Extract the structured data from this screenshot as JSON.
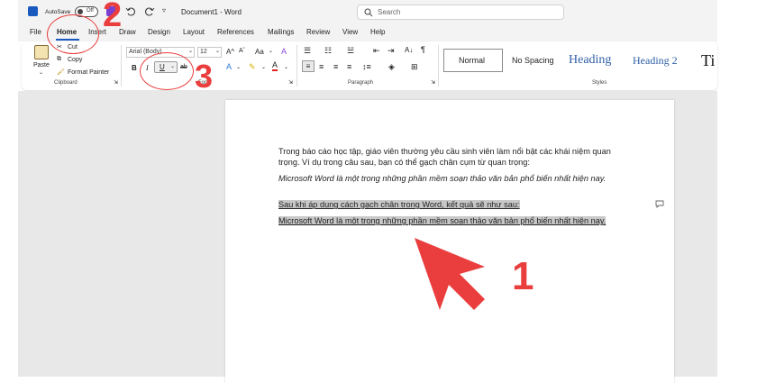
{
  "titlebar": {
    "autosave_label": "AutoSave",
    "autosave_state": "Off",
    "doc_title": "Document1 - Word",
    "search_placeholder": "Search"
  },
  "tabs": [
    "File",
    "Home",
    "Insert",
    "Draw",
    "Design",
    "Layout",
    "References",
    "Mailings",
    "Review",
    "View",
    "Help"
  ],
  "active_tab": "Home",
  "clipboard": {
    "paste_label": "Paste",
    "cut_label": "Cut",
    "copy_label": "Copy",
    "format_painter_label": "Format Painter",
    "group_label": "Clipboard"
  },
  "font": {
    "font_name": "Arial (Body)",
    "font_size": "12",
    "group_label": "Font",
    "grow_label": "A^",
    "shrink_label": "Aˇ",
    "case_label": "Aa",
    "bold_label": "B",
    "italic_label": "I",
    "underline_label": "U",
    "strike_label": "ab"
  },
  "paragraph": {
    "group_label": "Paragraph"
  },
  "styles": {
    "items": [
      "Normal",
      "No Spacing",
      "Heading",
      "Heading 2",
      "Ti"
    ],
    "group_label": "Styles"
  },
  "document": {
    "paragraphs": [
      "Trong báo cáo học tập, giáo viên thường yêu cầu sinh viên làm nổi bật các khái niệm quan trọng. Ví dụ trong câu sau, bạn có thể gạch chân cụm từ quan trọng:",
      "Microsoft Word là một trong những phần mềm soạn thảo văn bản phổ biến nhất hiện nay.",
      "Sau khi áp dụng cách gạch chân trong Word, kết quả sẽ như sau:",
      "Microsoft Word là một trong những phần mềm soạn thảo văn bản phổ biến nhất hiện nay."
    ]
  },
  "annotations": {
    "step1": "1",
    "step2": "2",
    "step3": "3"
  },
  "colors": {
    "accent": "#185abd",
    "annotation_red": "#ea3d3d",
    "word_blue": "#185abd"
  }
}
